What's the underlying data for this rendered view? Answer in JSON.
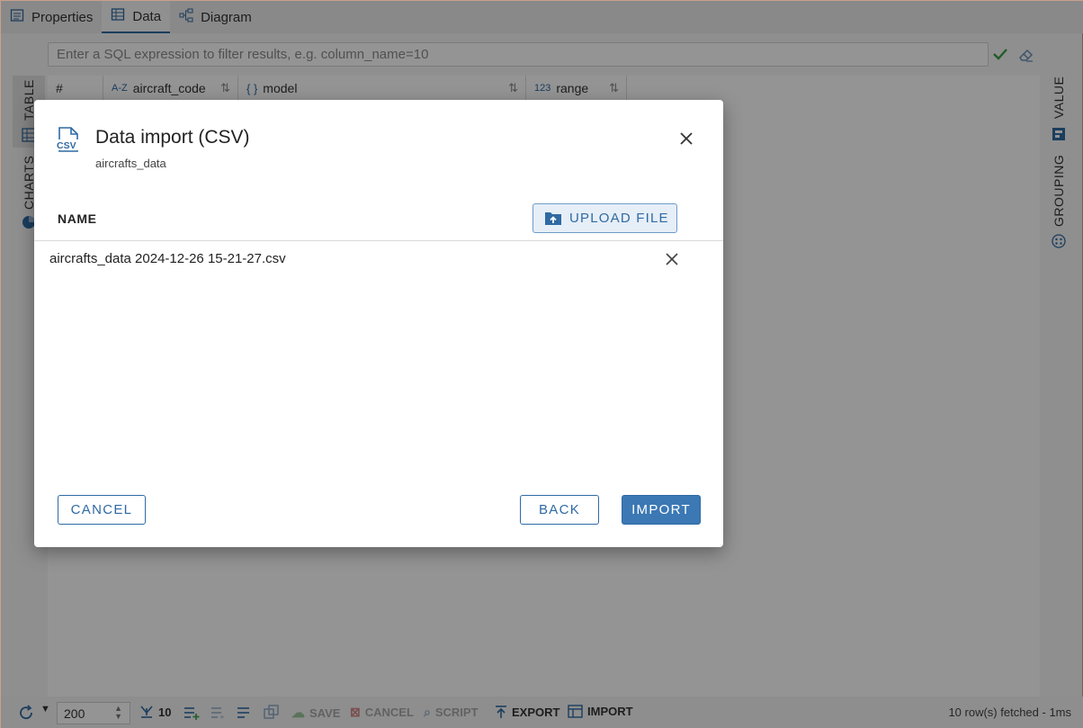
{
  "tabs": [
    {
      "label": "Properties"
    },
    {
      "label": "Data"
    },
    {
      "label": "Diagram"
    }
  ],
  "filter": {
    "placeholder": "Enter a SQL expression to filter results, e.g. column_name=10"
  },
  "left_tabs": {
    "table": "TABLE",
    "charts": "CHARTS"
  },
  "right_tabs": {
    "value": "VALUE",
    "grouping": "GROUPING"
  },
  "grid": {
    "columns": [
      {
        "label": "#",
        "type": ""
      },
      {
        "label": "aircraft_code",
        "type": "A-Z"
      },
      {
        "label": "model",
        "type": "{ }"
      },
      {
        "label": "range",
        "type": "123"
      }
    ]
  },
  "bottom": {
    "rows_limit": "200",
    "fetch_size": "10",
    "save": "SAVE",
    "cancel": "CANCEL",
    "script": "SCRIPT",
    "export": "EXPORT",
    "import": "IMPORT",
    "status": "10 row(s) fetched - 1ms"
  },
  "dialog": {
    "icon_text": "CSV",
    "title": "Data import (CSV)",
    "subtitle": "aircrafts_data",
    "column_name": "NAME",
    "upload_label": "UPLOAD FILE",
    "files": [
      "aircrafts_data 2024-12-26 15-21-27.csv"
    ],
    "cancel_label": "CANCEL",
    "back_label": "BACK",
    "import_label": "IMPORT"
  },
  "colors": {
    "accent": "#2f6aa3",
    "primary_button": "#3b78b4",
    "ok": "#3aa04a"
  }
}
